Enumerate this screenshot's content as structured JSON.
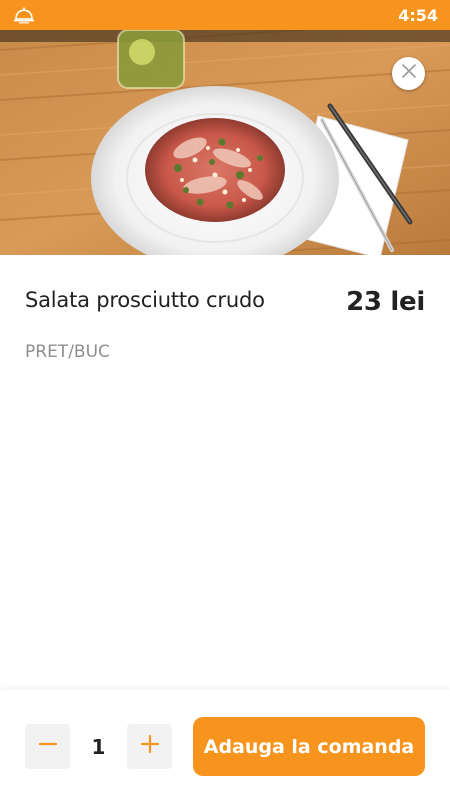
{
  "status_bar": {
    "time": "4:54",
    "icon": "bell-icon",
    "color": "#F7941D"
  },
  "hero": {
    "image": "salad-plate-photo",
    "close_icon": "close-icon"
  },
  "product": {
    "name": "Salata prosciutto crudo",
    "price": "23 lei",
    "unit": "PRET/BUC"
  },
  "cart": {
    "minus_icon": "minus-icon",
    "plus_icon": "plus-icon",
    "quantity": "1",
    "add_label": "Adauga la comanda",
    "accent_color": "#F7941D"
  }
}
